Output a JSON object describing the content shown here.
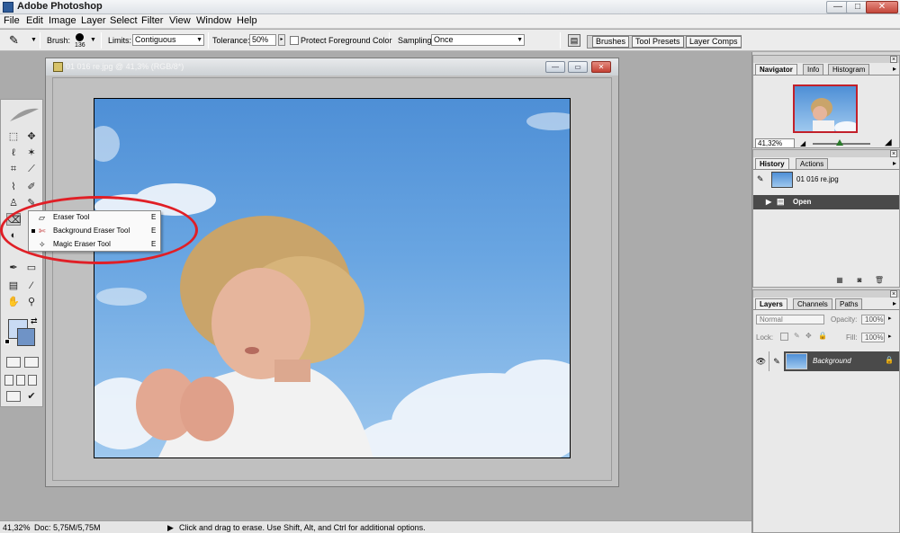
{
  "app": {
    "title": "Adobe Photoshop",
    "window_controls": {
      "minimize": "—",
      "maximize": "□",
      "close": "✕"
    }
  },
  "menubar": {
    "items": [
      "File",
      "Edit",
      "Image",
      "Layer",
      "Select",
      "Filter",
      "View",
      "Window",
      "Help"
    ]
  },
  "options": {
    "brush_label": "Brush:",
    "brush_size": "136",
    "limits_label": "Limits:",
    "limits_value": "Contiguous",
    "tolerance_label": "Tolerance:",
    "tolerance_value": "50%",
    "protect_label": "Protect Foreground Color",
    "sampling_label": "Sampling:",
    "sampling_value": "Once",
    "well_tabs": [
      "Brushes",
      "Tool Presets",
      "Layer Comps"
    ]
  },
  "document": {
    "title": "01 016 re.jpg @ 41,3% (RGB/8*)",
    "controls": {
      "minimize": "—",
      "maximize": "▭",
      "close": "✕"
    }
  },
  "flyout": {
    "items": [
      {
        "label": "Eraser Tool",
        "key": "E",
        "active": false
      },
      {
        "label": "Background Eraser Tool",
        "key": "E",
        "active": true
      },
      {
        "label": "Magic Eraser Tool",
        "key": "E",
        "active": false
      }
    ]
  },
  "status": {
    "zoom": "41,32%",
    "doc_size": "Doc: 5,75M/5,75M",
    "hint": "Click and drag to erase.  Use Shift, Alt, and Ctrl for additional options."
  },
  "navigator": {
    "tabs": [
      "Navigator",
      "Info",
      "Histogram"
    ],
    "zoom": "41,32%"
  },
  "history": {
    "tabs": [
      "History",
      "Actions"
    ],
    "snapshot_label": "01 016 re.jpg",
    "steps": [
      "Open"
    ]
  },
  "layers": {
    "tabs": [
      "Layers",
      "Channels",
      "Paths"
    ],
    "blend_mode": "Normal",
    "opacity_label": "Opacity:",
    "opacity_value": "100%",
    "lock_label": "Lock:",
    "fill_label": "Fill:",
    "fill_value": "100%",
    "layer_name": "Background"
  },
  "colors": {
    "annotation": "#e01f26",
    "foreground": "#c9dbf4",
    "background": "#6f93c6"
  },
  "icons": {
    "tool_preset": "eraser-brush-icon",
    "palette_well": "palette-icon"
  }
}
